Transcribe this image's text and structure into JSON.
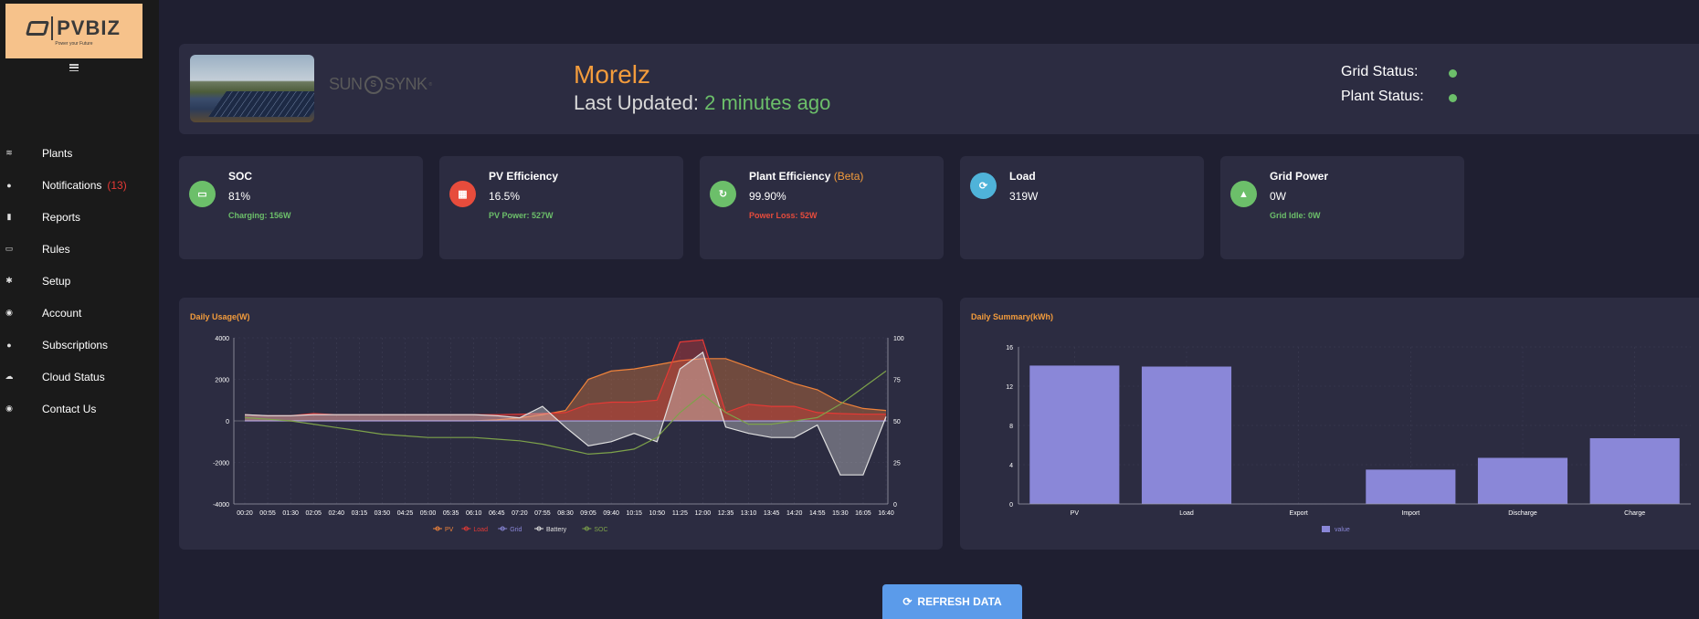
{
  "sidebar": {
    "logo_text": "PVBIZ",
    "logo_tagline": "Power your Future",
    "items": [
      {
        "label": "Plants",
        "icon": "plants-icon"
      },
      {
        "label": "Notifications",
        "icon": "bell-icon",
        "count": "(13)"
      },
      {
        "label": "Reports",
        "icon": "bar-chart-icon"
      },
      {
        "label": "Rules",
        "icon": "ruler-icon"
      },
      {
        "label": "Setup",
        "icon": "gear-icon"
      },
      {
        "label": "Account",
        "icon": "user-circle-icon"
      },
      {
        "label": "Subscriptions",
        "icon": "bell-icon"
      },
      {
        "label": "Cloud Status",
        "icon": "cloud-icon"
      },
      {
        "label": "Contact Us",
        "icon": "user-circle-icon"
      }
    ]
  },
  "header": {
    "brand": "SUN",
    "brand_mark": "S",
    "brand_tail": "SYNK",
    "brand_tm": "®",
    "plant_name": "Morelz",
    "last_updated_label": "Last Updated:",
    "last_updated_value": "2 minutes ago",
    "grid_status_label": "Grid Status:",
    "plant_status_label": "Plant Status:",
    "status_color": "#6cbf6a"
  },
  "metrics": [
    {
      "title": "SOC",
      "value": "81%",
      "sub": "Charging: 156W",
      "sub_color": "#6cbf6a",
      "icon": "battery-icon",
      "icon_color": "#6cbf6a",
      "glyph": "▭"
    },
    {
      "title": "PV Efficiency",
      "value": "16.5%",
      "sub": "PV Power: 527W",
      "sub_color": "#6cbf6a",
      "icon": "solar-panel-icon",
      "icon_color": "#e74c3c",
      "glyph": "▦"
    },
    {
      "title": "Plant Efficiency",
      "title_extra": "(Beta)",
      "value": "99.90%",
      "sub": "Power Loss: 52W",
      "sub_color": "#e74c3c",
      "icon": "recycle-icon",
      "icon_color": "#6cbf6a",
      "glyph": "↻"
    },
    {
      "title": "Load",
      "value": "319W",
      "sub": "",
      "sub_color": "#6cbf6a",
      "icon": "sync-icon",
      "icon_color": "#4fb3d9",
      "glyph": "⟳"
    },
    {
      "title": "Grid Power",
      "value": "0W",
      "sub": "Grid Idle: 0W",
      "sub_color": "#6cbf6a",
      "icon": "fire-icon",
      "icon_color": "#6cbf6a",
      "glyph": "▲"
    }
  ],
  "refresh_label": "REFRESH DATA",
  "chart_data": [
    {
      "type": "area",
      "title": "Daily Usage(W)",
      "x_ticks": [
        "00:20",
        "00:55",
        "01:30",
        "02:05",
        "02:40",
        "03:15",
        "03:50",
        "04:25",
        "05:00",
        "05:35",
        "06:10",
        "06:45",
        "07:20",
        "07:55",
        "08:30",
        "09:05",
        "09:40",
        "10:15",
        "10:50",
        "11:25",
        "12:00",
        "12:35",
        "13:10",
        "13:45",
        "14:20",
        "14:55",
        "15:30",
        "16:05",
        "16:40"
      ],
      "y_left": {
        "ticks": [
          "4000",
          "2000",
          "0",
          "-2000",
          "-4000"
        ],
        "range": [
          -4000,
          4000
        ]
      },
      "y_right": {
        "ticks": [
          "100",
          "75",
          "50",
          "25",
          "0"
        ],
        "range": [
          0,
          100
        ]
      },
      "series": [
        {
          "name": "PV",
          "color": "#f0833a",
          "axis": "left",
          "values": [
            0,
            0,
            0,
            0,
            0,
            0,
            0,
            0,
            0,
            0,
            0,
            50,
            150,
            300,
            500,
            2000,
            2400,
            2500,
            2700,
            2900,
            3000,
            3000,
            2600,
            2200,
            1800,
            1500,
            900,
            600,
            500
          ]
        },
        {
          "name": "Load",
          "color": "#e53935",
          "axis": "left",
          "values": [
            300,
            250,
            250,
            350,
            300,
            300,
            300,
            300,
            300,
            300,
            300,
            300,
            320,
            350,
            400,
            800,
            900,
            900,
            1000,
            3800,
            3900,
            400,
            800,
            700,
            700,
            400,
            350,
            320,
            320
          ]
        },
        {
          "name": "Grid",
          "color": "#8a87d8",
          "axis": "left",
          "values": [
            0,
            0,
            0,
            0,
            0,
            0,
            0,
            0,
            0,
            0,
            0,
            0,
            0,
            0,
            0,
            0,
            0,
            0,
            0,
            0,
            0,
            0,
            0,
            0,
            0,
            0,
            0,
            0,
            0
          ]
        },
        {
          "name": "Battery",
          "color": "#e0e0e0",
          "axis": "left",
          "values": [
            300,
            250,
            250,
            300,
            300,
            300,
            300,
            300,
            300,
            300,
            300,
            250,
            150,
            700,
            -300,
            -1200,
            -1000,
            -600,
            -1000,
            2500,
            3300,
            -300,
            -600,
            -800,
            -800,
            -200,
            -2600,
            -2600,
            200
          ]
        },
        {
          "name": "SOC",
          "color": "#7da24a",
          "axis": "right",
          "values": [
            52,
            51,
            50,
            48,
            46,
            44,
            42,
            41,
            40,
            40,
            40,
            39,
            38,
            36,
            33,
            30,
            31,
            33,
            40,
            55,
            66,
            55,
            48,
            48,
            50,
            52,
            60,
            70,
            80
          ]
        }
      ],
      "legend": "bottom"
    },
    {
      "type": "bar",
      "title": "Daily Summary(kWh)",
      "categories": [
        "PV",
        "Load",
        "Export",
        "Import",
        "Discharge",
        "Charge"
      ],
      "series": [
        {
          "name": "value",
          "color": "#8a87d8",
          "values": [
            14.1,
            14.0,
            0,
            3.5,
            4.7,
            6.7
          ]
        }
      ],
      "y_ticks": [
        "16",
        "12",
        "8",
        "4",
        "0"
      ],
      "ylim": [
        0,
        16
      ],
      "legend": "bottom"
    }
  ]
}
